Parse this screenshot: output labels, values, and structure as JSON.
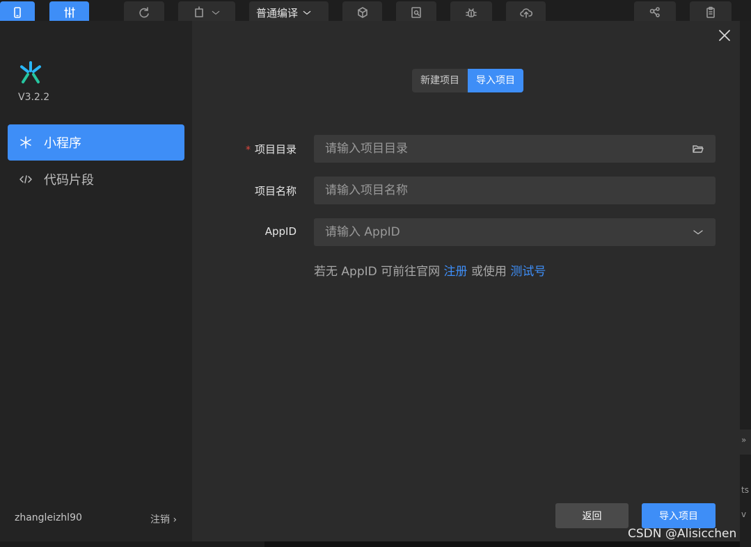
{
  "toolbar": {
    "compile_mode": "普通编译"
  },
  "background": {
    "right_labels": [
      "»",
      "ts",
      "v"
    ]
  },
  "sidebar": {
    "version": "V3.2.2",
    "items": [
      {
        "label": "小程序",
        "icon": "miniprogram-icon",
        "active": true
      },
      {
        "label": "代码片段",
        "icon": "code-icon",
        "active": false
      }
    ],
    "username": "zhangleizhl90",
    "logout_label": "注销 ›"
  },
  "main": {
    "tabs": [
      {
        "label": "新建项目",
        "active": false
      },
      {
        "label": "导入项目",
        "active": true
      }
    ],
    "form": {
      "required_mark": "*",
      "directory_label": "项目目录",
      "directory_placeholder": "请输入项目目录",
      "name_label": "项目名称",
      "name_placeholder": "请输入项目名称",
      "appid_label": "AppID",
      "appid_placeholder": "请输入 AppID"
    },
    "hint": {
      "prefix": "若无 AppID 可前往官网",
      "register_link": "注册",
      "middle": "或使用",
      "test_link": "测试号"
    },
    "buttons": {
      "back": "返回",
      "import": "导入项目"
    }
  },
  "watermark": "CSDN @Alisicchen",
  "colors": {
    "accent": "#3e8ef7",
    "dialog_bg": "#2b2b2b",
    "sidebar_bg": "#232323",
    "input_bg": "#3a3a3a",
    "required": "#e0473d"
  }
}
